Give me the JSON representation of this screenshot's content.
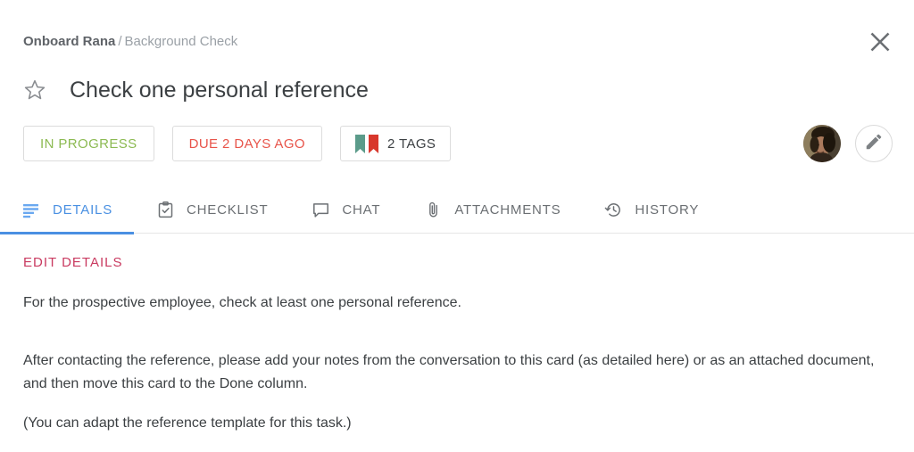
{
  "breadcrumb": {
    "parent": "Onboard Rana",
    "separator": "/",
    "current": "Background Check"
  },
  "header": {
    "close_icon": "close-icon",
    "star_icon": "star-outline-icon",
    "title": "Check one personal reference"
  },
  "badges": [
    {
      "label": "IN PROGRESS",
      "name": "status-badge",
      "color": "#8cba52"
    },
    {
      "label": "DUE 2 DAYS AGO",
      "name": "due-date-badge",
      "color": "#e8544a"
    },
    {
      "label": "2 TAGS",
      "name": "tags-badge",
      "color": "#3c4043"
    }
  ],
  "tags": {
    "count_label": "2 TAGS",
    "marks": [
      {
        "name": "tag-mark-green",
        "color": "#5b9b8a"
      },
      {
        "name": "tag-mark-red",
        "color": "#d8372c"
      }
    ]
  },
  "actions": {
    "avatar_name": "assignee-avatar",
    "edit_icon": "pencil-icon"
  },
  "tabs": [
    {
      "label": "DETAILS",
      "icon": "subject-lines-icon",
      "active": true
    },
    {
      "label": "CHECKLIST",
      "icon": "clipboard-check-icon",
      "active": false
    },
    {
      "label": "CHAT",
      "icon": "speech-bubble-icon",
      "active": false
    },
    {
      "label": "ATTACHMENTS",
      "icon": "paperclip-icon",
      "active": false
    },
    {
      "label": "HISTORY",
      "icon": "history-clock-icon",
      "active": false
    }
  ],
  "details": {
    "edit_link": "EDIT DETAILS",
    "paragraph_1": "For the prospective employee, check at least one personal reference.",
    "paragraph_2": "After contacting the reference, please add your notes from the conversation to this card (as detailed here) or as an attached document, and then move this card to the Done column.",
    "paragraph_3": "(You can adapt the reference template for this task.)"
  },
  "colors": {
    "accent_blue": "#4a90e2",
    "edit_link_pink": "#c93a60",
    "status_green": "#8cba52",
    "due_red": "#e8544a",
    "text_primary": "#3c4043",
    "text_muted": "#9aa0a6"
  }
}
